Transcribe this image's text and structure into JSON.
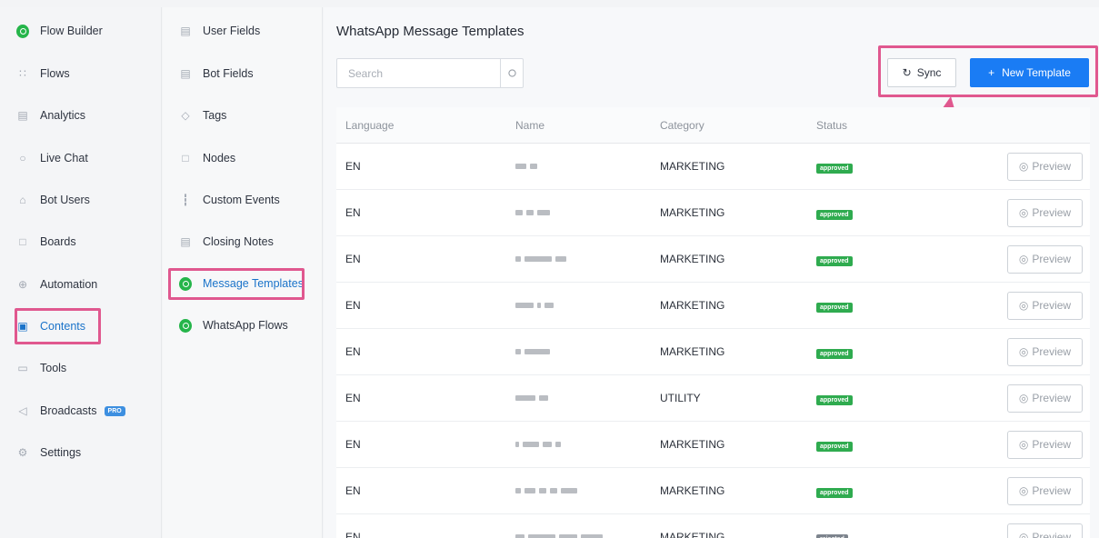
{
  "nav": {
    "items": [
      {
        "label": "Flow Builder",
        "icon": "whatsapp-icon"
      },
      {
        "label": "Flows",
        "icon": "flows-icon"
      },
      {
        "label": "Analytics",
        "icon": "analytics-icon"
      },
      {
        "label": "Live Chat",
        "icon": "chat-icon"
      },
      {
        "label": "Bot Users",
        "icon": "user-icon"
      },
      {
        "label": "Boards",
        "icon": "boards-icon"
      },
      {
        "label": "Automation",
        "icon": "automation-icon"
      },
      {
        "label": "Contents",
        "icon": "contents-icon"
      },
      {
        "label": "Tools",
        "icon": "tools-icon"
      },
      {
        "label": "Broadcasts",
        "icon": "megaphone-icon",
        "badge": "PRO"
      },
      {
        "label": "Settings",
        "icon": "gear-icon"
      }
    ]
  },
  "subnav": {
    "items": [
      {
        "label": "User Fields",
        "icon": "fields-icon"
      },
      {
        "label": "Bot Fields",
        "icon": "fields-icon"
      },
      {
        "label": "Tags",
        "icon": "tag-icon"
      },
      {
        "label": "Nodes",
        "icon": "nodes-icon"
      },
      {
        "label": "Custom Events",
        "icon": "bar-chart-icon"
      },
      {
        "label": "Closing Notes",
        "icon": "clipboard-icon"
      },
      {
        "label": "Message Templates",
        "icon": "whatsapp-icon"
      },
      {
        "label": "WhatsApp Flows",
        "icon": "whatsapp-icon"
      }
    ]
  },
  "main": {
    "title": "WhatsApp Message Templates",
    "search_placeholder": "Search",
    "sync_label": "Sync",
    "new_template_label": "New Template",
    "columns": [
      "Language",
      "Name",
      "Category",
      "Status"
    ],
    "preview_label": "Preview",
    "rows": [
      {
        "language": "EN",
        "category": "MARKETING",
        "status": "approved"
      },
      {
        "language": "EN",
        "category": "MARKETING",
        "status": "approved"
      },
      {
        "language": "EN",
        "category": "MARKETING",
        "status": "approved"
      },
      {
        "language": "EN",
        "category": "MARKETING",
        "status": "approved"
      },
      {
        "language": "EN",
        "category": "MARKETING",
        "status": "approved"
      },
      {
        "language": "EN",
        "category": "UTILITY",
        "status": "approved"
      },
      {
        "language": "EN",
        "category": "MARKETING",
        "status": "approved"
      },
      {
        "language": "EN",
        "category": "MARKETING",
        "status": "approved"
      },
      {
        "language": "EN",
        "category": "MARKETING",
        "status": "rejected"
      }
    ]
  },
  "colors": {
    "accent": "#1a7cf4",
    "highlight": "#e0588f",
    "approved": "#2fab4f",
    "rejected": "#7d848d",
    "whatsapp": "#25b54a"
  }
}
